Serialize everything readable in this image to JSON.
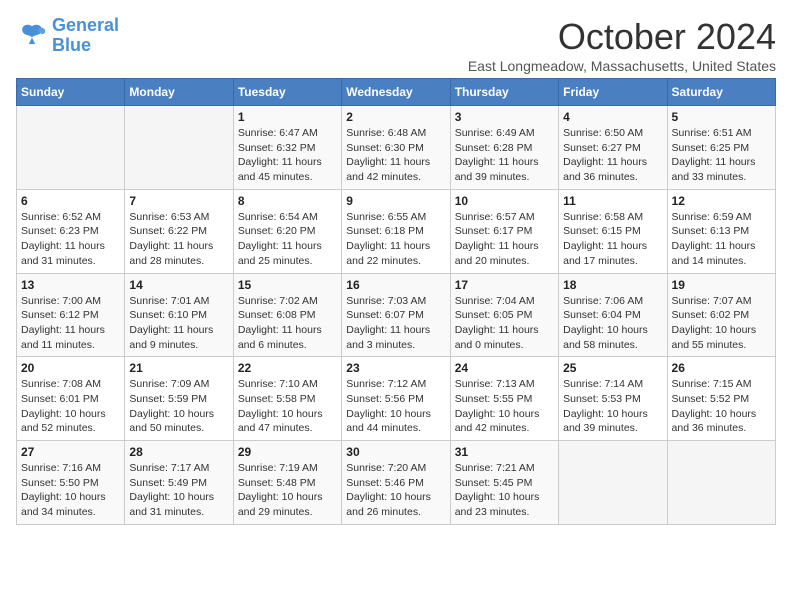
{
  "logo": {
    "line1": "General",
    "line2": "Blue"
  },
  "title": "October 2024",
  "location": "East Longmeadow, Massachusetts, United States",
  "weekdays": [
    "Sunday",
    "Monday",
    "Tuesday",
    "Wednesday",
    "Thursday",
    "Friday",
    "Saturday"
  ],
  "weeks": [
    [
      {
        "day": null,
        "info": null
      },
      {
        "day": null,
        "info": null
      },
      {
        "day": "1",
        "info": "Sunrise: 6:47 AM\nSunset: 6:32 PM\nDaylight: 11 hours and 45 minutes."
      },
      {
        "day": "2",
        "info": "Sunrise: 6:48 AM\nSunset: 6:30 PM\nDaylight: 11 hours and 42 minutes."
      },
      {
        "day": "3",
        "info": "Sunrise: 6:49 AM\nSunset: 6:28 PM\nDaylight: 11 hours and 39 minutes."
      },
      {
        "day": "4",
        "info": "Sunrise: 6:50 AM\nSunset: 6:27 PM\nDaylight: 11 hours and 36 minutes."
      },
      {
        "day": "5",
        "info": "Sunrise: 6:51 AM\nSunset: 6:25 PM\nDaylight: 11 hours and 33 minutes."
      }
    ],
    [
      {
        "day": "6",
        "info": "Sunrise: 6:52 AM\nSunset: 6:23 PM\nDaylight: 11 hours and 31 minutes."
      },
      {
        "day": "7",
        "info": "Sunrise: 6:53 AM\nSunset: 6:22 PM\nDaylight: 11 hours and 28 minutes."
      },
      {
        "day": "8",
        "info": "Sunrise: 6:54 AM\nSunset: 6:20 PM\nDaylight: 11 hours and 25 minutes."
      },
      {
        "day": "9",
        "info": "Sunrise: 6:55 AM\nSunset: 6:18 PM\nDaylight: 11 hours and 22 minutes."
      },
      {
        "day": "10",
        "info": "Sunrise: 6:57 AM\nSunset: 6:17 PM\nDaylight: 11 hours and 20 minutes."
      },
      {
        "day": "11",
        "info": "Sunrise: 6:58 AM\nSunset: 6:15 PM\nDaylight: 11 hours and 17 minutes."
      },
      {
        "day": "12",
        "info": "Sunrise: 6:59 AM\nSunset: 6:13 PM\nDaylight: 11 hours and 14 minutes."
      }
    ],
    [
      {
        "day": "13",
        "info": "Sunrise: 7:00 AM\nSunset: 6:12 PM\nDaylight: 11 hours and 11 minutes."
      },
      {
        "day": "14",
        "info": "Sunrise: 7:01 AM\nSunset: 6:10 PM\nDaylight: 11 hours and 9 minutes."
      },
      {
        "day": "15",
        "info": "Sunrise: 7:02 AM\nSunset: 6:08 PM\nDaylight: 11 hours and 6 minutes."
      },
      {
        "day": "16",
        "info": "Sunrise: 7:03 AM\nSunset: 6:07 PM\nDaylight: 11 hours and 3 minutes."
      },
      {
        "day": "17",
        "info": "Sunrise: 7:04 AM\nSunset: 6:05 PM\nDaylight: 11 hours and 0 minutes."
      },
      {
        "day": "18",
        "info": "Sunrise: 7:06 AM\nSunset: 6:04 PM\nDaylight: 10 hours and 58 minutes."
      },
      {
        "day": "19",
        "info": "Sunrise: 7:07 AM\nSunset: 6:02 PM\nDaylight: 10 hours and 55 minutes."
      }
    ],
    [
      {
        "day": "20",
        "info": "Sunrise: 7:08 AM\nSunset: 6:01 PM\nDaylight: 10 hours and 52 minutes."
      },
      {
        "day": "21",
        "info": "Sunrise: 7:09 AM\nSunset: 5:59 PM\nDaylight: 10 hours and 50 minutes."
      },
      {
        "day": "22",
        "info": "Sunrise: 7:10 AM\nSunset: 5:58 PM\nDaylight: 10 hours and 47 minutes."
      },
      {
        "day": "23",
        "info": "Sunrise: 7:12 AM\nSunset: 5:56 PM\nDaylight: 10 hours and 44 minutes."
      },
      {
        "day": "24",
        "info": "Sunrise: 7:13 AM\nSunset: 5:55 PM\nDaylight: 10 hours and 42 minutes."
      },
      {
        "day": "25",
        "info": "Sunrise: 7:14 AM\nSunset: 5:53 PM\nDaylight: 10 hours and 39 minutes."
      },
      {
        "day": "26",
        "info": "Sunrise: 7:15 AM\nSunset: 5:52 PM\nDaylight: 10 hours and 36 minutes."
      }
    ],
    [
      {
        "day": "27",
        "info": "Sunrise: 7:16 AM\nSunset: 5:50 PM\nDaylight: 10 hours and 34 minutes."
      },
      {
        "day": "28",
        "info": "Sunrise: 7:17 AM\nSunset: 5:49 PM\nDaylight: 10 hours and 31 minutes."
      },
      {
        "day": "29",
        "info": "Sunrise: 7:19 AM\nSunset: 5:48 PM\nDaylight: 10 hours and 29 minutes."
      },
      {
        "day": "30",
        "info": "Sunrise: 7:20 AM\nSunset: 5:46 PM\nDaylight: 10 hours and 26 minutes."
      },
      {
        "day": "31",
        "info": "Sunrise: 7:21 AM\nSunset: 5:45 PM\nDaylight: 10 hours and 23 minutes."
      },
      {
        "day": null,
        "info": null
      },
      {
        "day": null,
        "info": null
      }
    ]
  ]
}
